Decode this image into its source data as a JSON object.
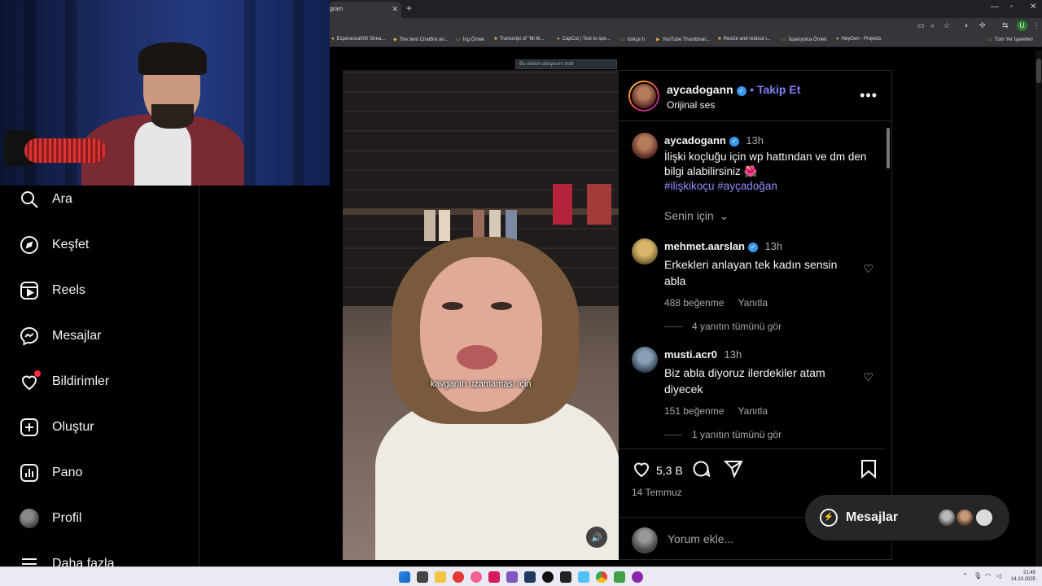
{
  "browser": {
    "tab_title": "gram",
    "bookmarks": [
      "Esperanza000 Strea...",
      "The best ChatBot an...",
      "İng Örnek",
      "Transcript of \"Mi M...",
      "CapCut | Text to spe...",
      "türkçe h",
      "YouTube Thumbnail...",
      "Resize and reduce i...",
      "İspanyolca Örnek",
      "HeyGen - Projects"
    ],
    "all_bookmarks": "Tüm Yer İşaretleri",
    "account_initial": "U",
    "download_hint": "Bu videon dosyasını indir"
  },
  "sidebar": {
    "items": [
      {
        "label": "Ara",
        "icon": "search-icon"
      },
      {
        "label": "Keşfet",
        "icon": "compass-icon"
      },
      {
        "label": "Reels",
        "icon": "reels-icon"
      },
      {
        "label": "Mesajlar",
        "icon": "messenger-icon"
      },
      {
        "label": "Bildirimler",
        "icon": "heart-icon"
      },
      {
        "label": "Oluştur",
        "icon": "plus-square-icon"
      },
      {
        "label": "Pano",
        "icon": "chart-icon"
      },
      {
        "label": "Profil",
        "icon": "avatar-icon"
      },
      {
        "label": "Daha fazla",
        "icon": "menu-icon"
      }
    ]
  },
  "video": {
    "caption": "kavganın uzamaması için"
  },
  "post": {
    "author": "aycadogann",
    "follow_label": "Takip Et",
    "audio": "Orijinal ses",
    "caption_time": "13h",
    "caption_text": "İlişki koçluğu için wp hattından ve dm den bilgi alabilirsiniz 🌺",
    "hashtags": "#ilişkikoçu #ayçadoğan",
    "filter_label": "Senin için",
    "comments": [
      {
        "user": "mehmet.aarslan",
        "verified": true,
        "time": "13h",
        "text": "Erkekleri anlayan tek kadın sensin abla",
        "likes": "488 beğenme",
        "reply_label": "Yanıtla",
        "view_replies": "4 yanıtın tümünü gör"
      },
      {
        "user": "musti.acr0",
        "verified": false,
        "time": "13h",
        "text": "Biz abla diyoruz ilerdekiler atam diyecek",
        "likes": "151 beğenme",
        "reply_label": "Yanıtla",
        "view_replies": "1 yanıtın tümünü gör"
      }
    ],
    "like_count": "5,3 B",
    "date": "14 Temmuz",
    "comment_placeholder": "Yorum ekle..."
  },
  "messages_float": {
    "label": "Mesajlar"
  },
  "taskbar": {
    "time": "21:45",
    "date": "14.10.2025"
  },
  "colors": {
    "accent_link": "#8f8ff8",
    "verified_blue": "#3897f0",
    "notification_red": "#ff3040"
  }
}
